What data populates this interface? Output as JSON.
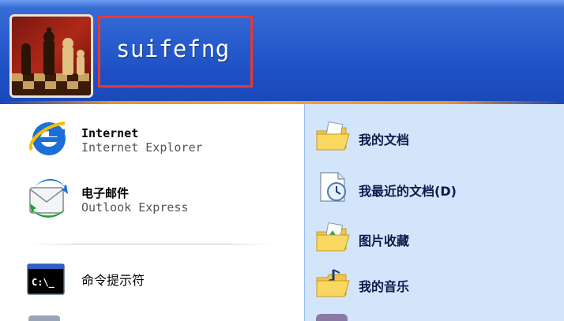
{
  "user": {
    "name": "suifefng"
  },
  "pinned": [
    {
      "title": "Internet",
      "subtitle": "Internet Explorer",
      "icon": "internet-explorer-icon"
    },
    {
      "title": "电子邮件",
      "subtitle": "Outlook Express",
      "icon": "outlook-express-icon"
    }
  ],
  "recent": [
    {
      "label": "命令提示符",
      "icon": "command-prompt-icon"
    }
  ],
  "places": [
    {
      "label": "我的文档",
      "icon": "my-documents-folder-icon"
    },
    {
      "label": "我最近的文档(D)",
      "icon": "recent-documents-icon"
    },
    {
      "label": "图片收藏",
      "icon": "my-pictures-folder-icon"
    },
    {
      "label": "我的音乐",
      "icon": "my-music-folder-icon"
    }
  ],
  "colors": {
    "header_blue": "#2a5fd0",
    "right_pane": "#d3e5fa",
    "highlight_box": "#e53935"
  }
}
